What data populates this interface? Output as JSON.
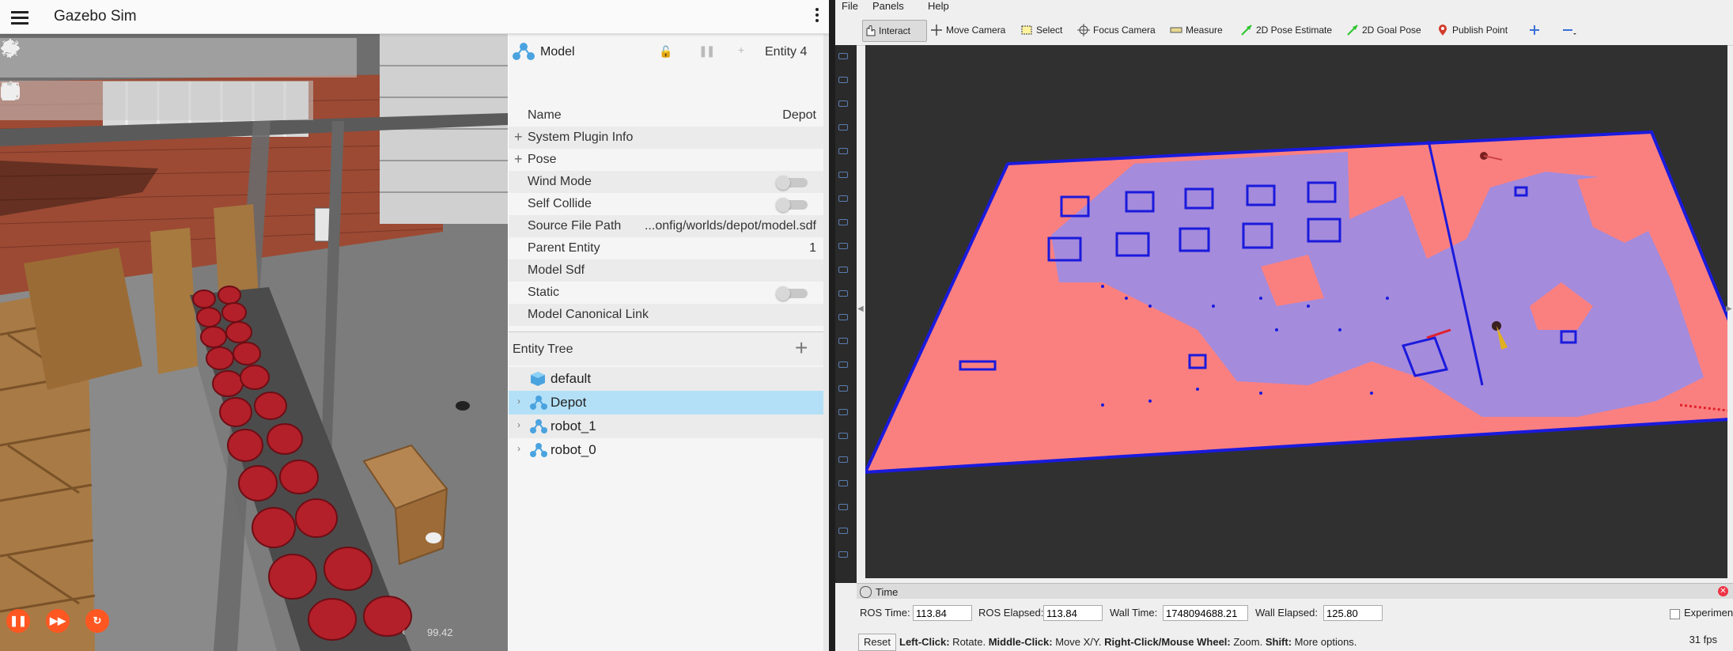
{
  "gazebo": {
    "title": "Gazebo Sim",
    "rtf": "99.42",
    "inspector": {
      "type_label": "Model",
      "entity": "Entity 4",
      "rows": [
        {
          "key": "Name",
          "value": "Depot"
        },
        {
          "key": "System Plugin Info",
          "expandable": true
        },
        {
          "key": "Pose",
          "expandable": true
        },
        {
          "key": "Wind Mode",
          "toggle": false
        },
        {
          "key": "Self Collide",
          "toggle": false
        },
        {
          "key": "Source File Path",
          "value": "...onfig/worlds/depot/model.sdf"
        },
        {
          "key": "Parent Entity",
          "value": "1"
        },
        {
          "key": "Model Sdf"
        },
        {
          "key": "Static",
          "toggle": false
        },
        {
          "key": "Model Canonical Link"
        }
      ]
    },
    "entity_tree": {
      "title": "Entity Tree",
      "items": [
        {
          "label": "default",
          "icon": "world-cube-icon",
          "selected": false
        },
        {
          "label": "Depot",
          "icon": "model-icon",
          "selected": true
        },
        {
          "label": "robot_1",
          "icon": "model-icon",
          "selected": false
        },
        {
          "label": "robot_0",
          "icon": "model-icon",
          "selected": false
        }
      ]
    }
  },
  "rviz": {
    "menu": [
      "File",
      "Panels",
      "Help"
    ],
    "tools": [
      "Interact",
      "Move Camera",
      "Select",
      "Focus Camera",
      "Measure",
      "2D Pose Estimate",
      "2D Goal Pose",
      "Publish Point"
    ],
    "time_panel": {
      "title": "Time",
      "ros_time_label": "ROS Time:",
      "ros_time": "113.84",
      "ros_elapsed_label": "ROS Elapsed:",
      "ros_elapsed": "113.84",
      "wall_time_label": "Wall Time:",
      "wall_time": "1748094688.21",
      "wall_elapsed_label": "Wall Elapsed:",
      "wall_elapsed": "125.80",
      "experimental_label": "Experimental"
    },
    "status": {
      "reset": "Reset",
      "left_click": "Left-Click:",
      "left_click_desc": " Rotate. ",
      "middle_click": "Middle-Click:",
      "middle_click_desc": " Move X/Y. ",
      "right_click": "Right-Click/Mouse Wheel:",
      "right_click_desc": " Zoom. ",
      "shift": "Shift:",
      "shift_desc": " More options.",
      "fps": "31 fps"
    }
  },
  "colors": {
    "gazebo_accent": "#ff5722",
    "selection": "#b3e0f7",
    "costmap_free": "#fa8080",
    "costmap_inflated": "#a48bdc",
    "costmap_obstacle": "#1a1adc"
  }
}
